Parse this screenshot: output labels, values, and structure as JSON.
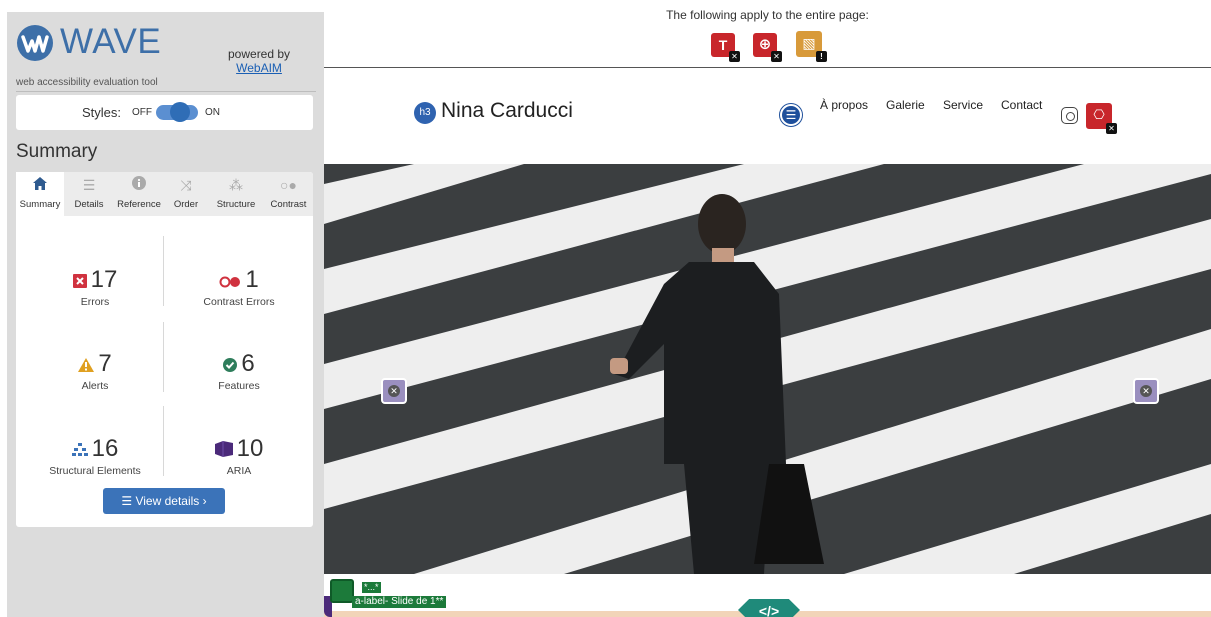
{
  "wave": {
    "logo": "WAVE",
    "tagline": "web accessibility evaluation tool",
    "powered_by": "powered by",
    "powered_link": "WebAIM",
    "styles_label": "Styles:",
    "styles_off": "OFF",
    "styles_on": "ON",
    "summary_title": "Summary",
    "tabs": [
      {
        "label": "Summary",
        "icon": "home-icon"
      },
      {
        "label": "Details",
        "icon": "list-icon"
      },
      {
        "label": "Reference",
        "icon": "info-icon"
      },
      {
        "label": "Order",
        "icon": "order-icon"
      },
      {
        "label": "Structure",
        "icon": "structure-icon"
      },
      {
        "label": "Contrast",
        "icon": "contrast-icon"
      }
    ],
    "stats": {
      "errors": {
        "value": "17",
        "label": "Errors"
      },
      "contrast": {
        "value": "1",
        "label": "Contrast Errors"
      },
      "alerts": {
        "value": "7",
        "label": "Alerts"
      },
      "features": {
        "value": "6",
        "label": "Features"
      },
      "structure": {
        "value": "16",
        "label": "Structural Elements"
      },
      "aria": {
        "value": "10",
        "label": "ARIA"
      }
    },
    "view_details": "View details ›",
    "colors": {
      "accent": "#3b73b9",
      "error": "#d0323f",
      "alert": "#e0a020",
      "feature": "#2e7d5b",
      "aria": "#4b2a7a"
    }
  },
  "page": {
    "banner_text": "The following apply to the entire page:",
    "site_title": "Nina Carducci",
    "h3_badge": "h3",
    "nav": [
      "À propos",
      "Galerie",
      "Service",
      "Contact"
    ],
    "alt_text": "a-label- Slide de 1**",
    "alt_text_short": "*...*",
    "code_badge": "</>"
  }
}
